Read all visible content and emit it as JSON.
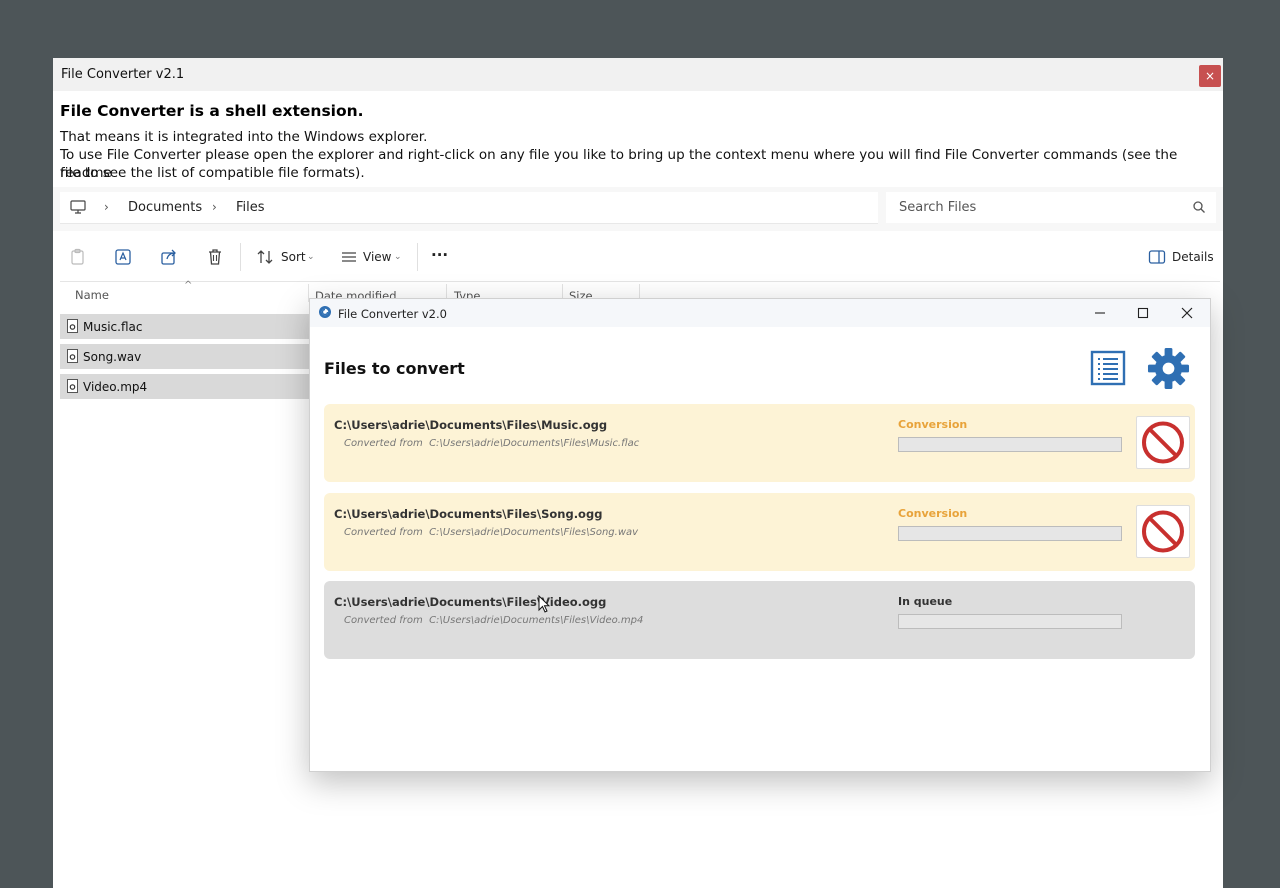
{
  "outer_window": {
    "title": "File Converter v2.1",
    "close_glyph": "×"
  },
  "intro": {
    "heading": "File Converter is a shell extension.",
    "line1": "That means it is integrated into the Windows explorer.",
    "line2": "To use File Converter please open the explorer and right-click on any file you like to bring up the context menu where you will find File Converter commands (see the readme",
    "line3": "file to see the list of compatible file formats)."
  },
  "explorer": {
    "breadcrumb": [
      "Documents",
      "Files"
    ],
    "search_placeholder": "Search Files",
    "toolbar": {
      "sort_label": "Sort",
      "view_label": "View",
      "more_label": "···",
      "details_label": "Details"
    },
    "columns": [
      "Name",
      "Date modified",
      "Type",
      "Size"
    ],
    "files": [
      "Music.flac",
      "Song.wav",
      "Video.mp4"
    ]
  },
  "converter": {
    "title": "File Converter v2.0",
    "heading": "Files to convert",
    "jobs": [
      {
        "path": "C:\\Users\\adrie\\Documents\\Files\\Music.ogg",
        "from_label": "Converted from",
        "from_path": "C:\\Users\\adrie\\Documents\\Files\\Music.flac",
        "status": "Conversion",
        "progress": 0
      },
      {
        "path": "C:\\Users\\adrie\\Documents\\Files\\Song.ogg",
        "from_label": "Converted from",
        "from_path": "C:\\Users\\adrie\\Documents\\Files\\Song.wav",
        "status": "Conversion",
        "progress": 0
      },
      {
        "path": "C:\\Users\\adrie\\Documents\\Files\\Video.ogg",
        "from_label": "Converted from",
        "from_path": "C:\\Users\\adrie\\Documents\\Files\\Video.mp4",
        "status": "In queue",
        "progress": 0
      }
    ]
  },
  "colors": {
    "conversion_status": "#e8a33a",
    "active_job_bg": "#fdf3d6",
    "queued_job_bg": "#dddddd",
    "accent_blue": "#2f6fb3",
    "cancel_red": "#c8302e"
  }
}
